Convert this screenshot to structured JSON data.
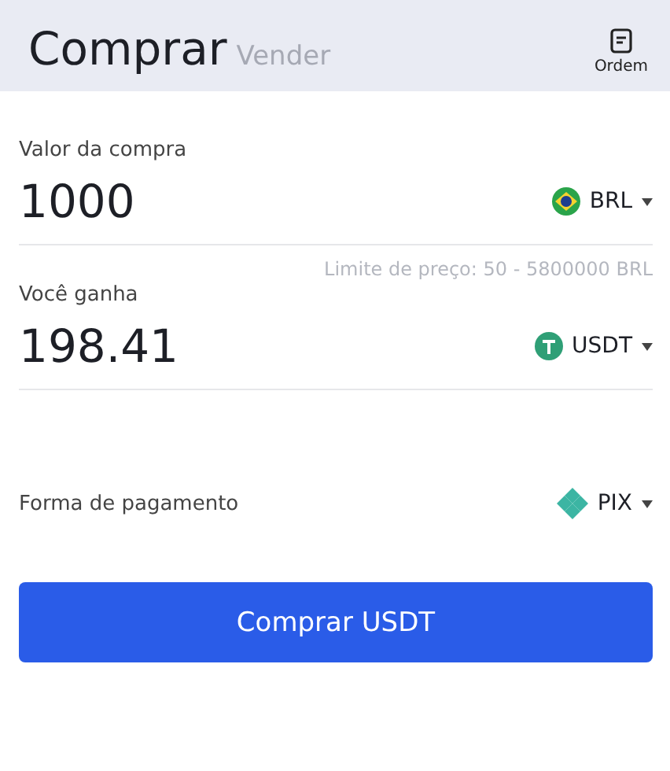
{
  "header": {
    "tabs": [
      {
        "label": "Comprar",
        "selected": true
      },
      {
        "label": "Vender",
        "selected": false
      }
    ],
    "order_button": {
      "label": "Ordem"
    }
  },
  "amount": {
    "label": "Valor da compra",
    "value": "1000",
    "currency": {
      "code": "BRL",
      "kind": "brl"
    }
  },
  "limit": "Limite de preço:  50 - 5800000 BRL",
  "receive": {
    "label": "Você ganha",
    "value": "198.41",
    "currency": {
      "code": "USDT",
      "kind": "usdt"
    }
  },
  "payment": {
    "label": "Forma de pagamento",
    "method": {
      "code": "PIX",
      "kind": "pix"
    }
  },
  "submit": "Comprar USDT"
}
